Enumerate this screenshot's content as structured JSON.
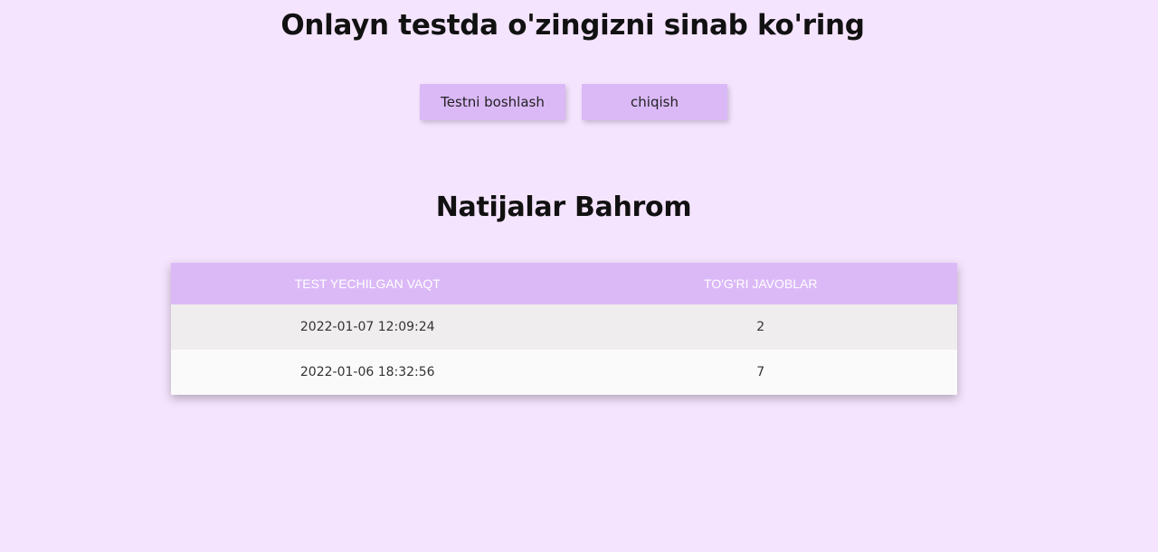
{
  "header": {
    "title": "Onlayn testda o'zingizni sinab ko'ring"
  },
  "actions": {
    "start_label": "Testni boshlash",
    "exit_label": "chiqish"
  },
  "results": {
    "title": "Natijalar Bahrom",
    "columns": [
      "TEST YECHILGAN VAQT",
      "TO'G'RI JAVOBLAR"
    ],
    "rows": [
      {
        "time": "2022-01-07 12:09:24",
        "correct": "2"
      },
      {
        "time": "2022-01-06 18:32:56",
        "correct": "7"
      }
    ]
  },
  "colors": {
    "background": "#f5e4fe",
    "accent": "#dbb9f7",
    "row_odd": "#efeded",
    "row_even": "#fafafa"
  }
}
